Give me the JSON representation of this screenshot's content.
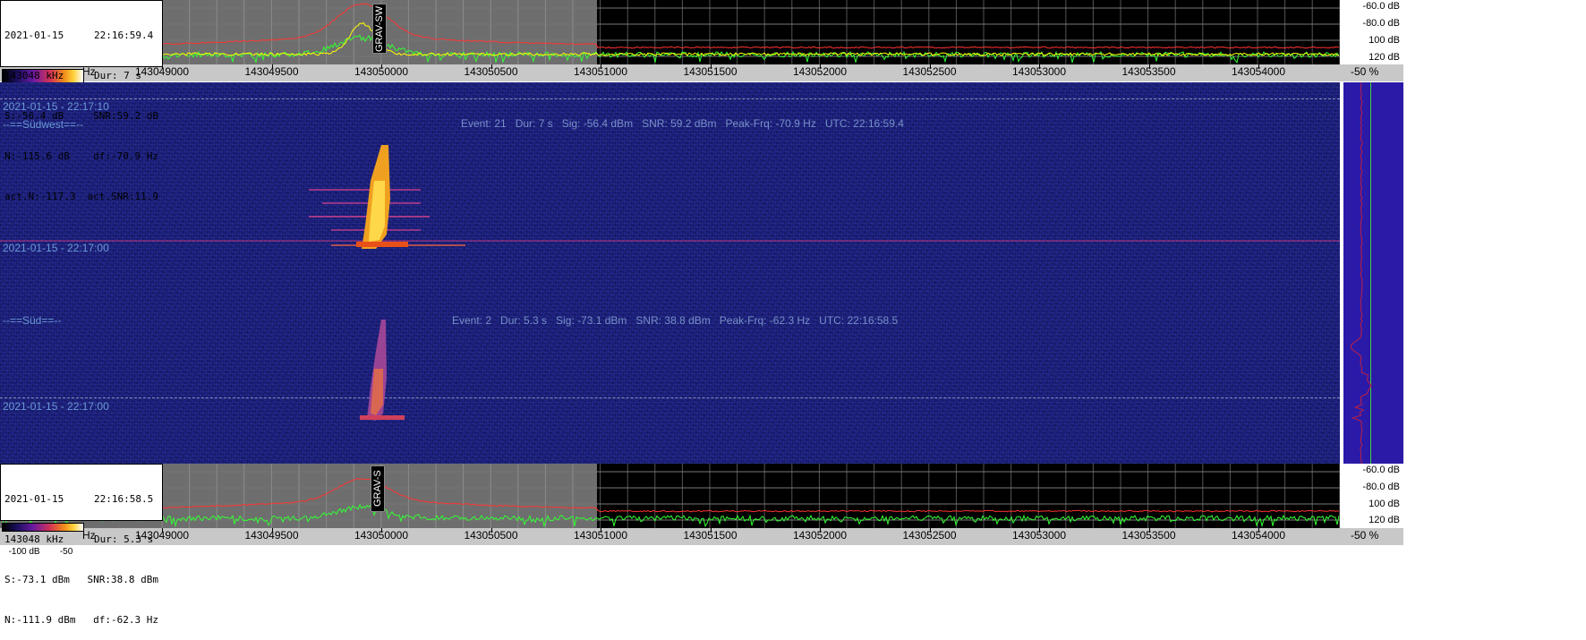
{
  "top_info": {
    "date": "2021-01-15",
    "time": "22:16:59.4",
    "freq": "143048 kHz",
    "dur": "Dur: 7 s",
    "signal": "S:-56.4 dB",
    "snr": "SNR:59.2 dB",
    "noise": "N:-115.6 dB",
    "df": "df:-70.9 Hz",
    "act_noise": "act.N:-117.3",
    "act_snr": "act.SNR:11.9"
  },
  "bottom_info": {
    "date": "2021-01-15",
    "time": "22:16:58.5",
    "freq": "143048 kHz",
    "dur": "Dur: 5.3 s",
    "signal": "S:-73.1 dBm",
    "snr": "SNR:38.8 dBm",
    "noise": "N:-111.9 dBm",
    "df": "df:-62.3 Hz"
  },
  "top_spectrum": {
    "marker_label": "GRAV-SW"
  },
  "bottom_spectrum": {
    "marker_label": "GRAV-S"
  },
  "db_scale": [
    "-60.0 dB",
    "-80.0 dB",
    "100 dB",
    "120 dB"
  ],
  "freq_axis": {
    "unit_fragment": "Hz",
    "ticks": [
      "143049000",
      "143049500",
      "143050000",
      "143050500",
      "143051000",
      "143051500",
      "143052000",
      "143052500",
      "143053000",
      "143053500",
      "143054000"
    ]
  },
  "percent_label": "-50 %",
  "colorbar_label": "-100 dB        -50",
  "waterfall": {
    "timestamps": [
      "2021-01-15 - 22:17:10",
      "2021-01-15 - 22:17:00",
      "2021-01-15 - 22:17:00"
    ],
    "region_labels": [
      "--==Südwest==--",
      "--==Süd==--"
    ],
    "events": [
      "Event: 21   Dur: 7 s   Sig: -56.4 dBm   SNR: 59.2 dBm   Peak-Frq: -70.9 Hz   UTC: 22:16:59.4",
      "Event: 2   Dur: 5.3 s   Sig: -73.1 dBm   SNR: 38.8 dBm   Peak-Frq: -62.3 Hz   UTC: 22:16:58.5"
    ]
  },
  "colors": {
    "waterfall_bg": "#1a1f78",
    "spectrum_grey": "#6e6e6e",
    "spectrum_black": "#000000",
    "trace_green": "#33ff33",
    "trace_red": "#ff3333",
    "trace_yellow": "#ffff00",
    "sidebar": "#2b1aa8"
  }
}
